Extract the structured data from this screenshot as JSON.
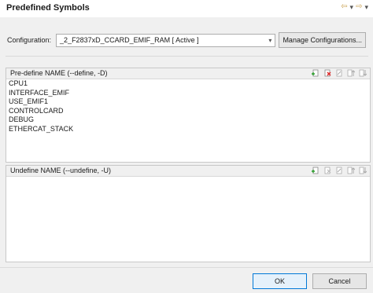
{
  "dialog": {
    "title": "Predefined Symbols"
  },
  "configuration": {
    "label": "Configuration:",
    "selected": "_2_F2837xD_CCARD_EMIF_RAM  [ Active ]",
    "manage_label": "Manage Configurations..."
  },
  "predefine": {
    "title": "Pre-define NAME (--define, -D)",
    "items": [
      "CPU1",
      "INTERFACE_EMIF",
      "USE_EMIF1",
      "CONTROLCARD",
      "DEBUG",
      "ETHERCAT_STACK"
    ]
  },
  "undefine": {
    "title": "Undefine NAME (--undefine, -U)",
    "items": []
  },
  "buttons": {
    "ok": "OK",
    "cancel": "Cancel"
  },
  "icons": {
    "nav_back": "back-arrow-icon",
    "nav_menu": "dropdown-icon",
    "nav_forward": "forward-arrow-icon",
    "add": "add-icon",
    "delete": "delete-icon",
    "edit": "edit-icon",
    "move_up": "move-up-icon",
    "move_down": "move-down-icon"
  }
}
